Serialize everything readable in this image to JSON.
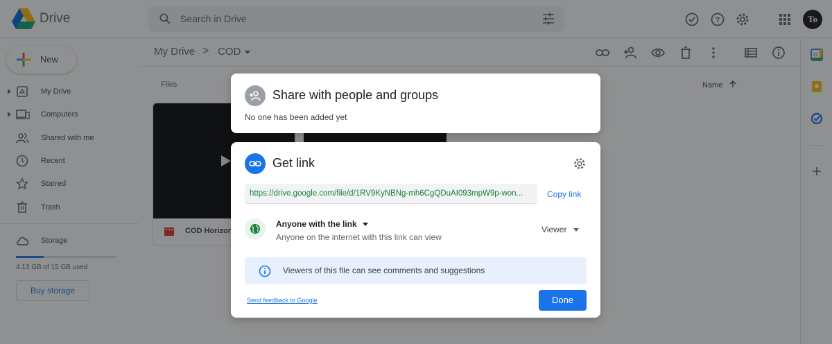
{
  "header": {
    "app_name": "Drive",
    "search_placeholder": "Search in Drive",
    "avatar_initials": "To"
  },
  "sidebar": {
    "new_label": "New",
    "items": [
      {
        "label": "My Drive",
        "icon": "my-drive-icon"
      },
      {
        "label": "Computers",
        "icon": "computers-icon"
      },
      {
        "label": "Shared with me",
        "icon": "shared-icon"
      },
      {
        "label": "Recent",
        "icon": "clock-icon"
      },
      {
        "label": "Starred",
        "icon": "star-icon"
      },
      {
        "label": "Trash",
        "icon": "trash-icon"
      }
    ],
    "storage_label": "Storage",
    "storage_used": "4.13 GB of 15 GB used",
    "storage_fraction": 0.275,
    "buy_storage": "Buy storage"
  },
  "breadcrumb": {
    "root": "My Drive",
    "separator": ">",
    "current": "COD"
  },
  "main": {
    "files_label": "Files",
    "sort_label": "Name",
    "file_name": "COD Horizont"
  },
  "share_dialog": {
    "title": "Share with people and groups",
    "subtitle": "No one has been added yet"
  },
  "link_dialog": {
    "title": "Get link",
    "url": "https://drive.google.com/file/d/1RV9KyNBNg-mh6CgQDuAI093mpW9p-won...",
    "copy_label": "Copy link",
    "access_title": "Anyone with the link",
    "access_description": "Anyone on the internet with this link can view",
    "role": "Viewer",
    "info": "Viewers of this file can see comments and suggestions",
    "feedback": "Send feedback to Google",
    "done": "Done"
  },
  "colors": {
    "accent": "#1a73e8",
    "link_green": "#188038",
    "overlay": "rgba(32,33,36,0.5)"
  }
}
